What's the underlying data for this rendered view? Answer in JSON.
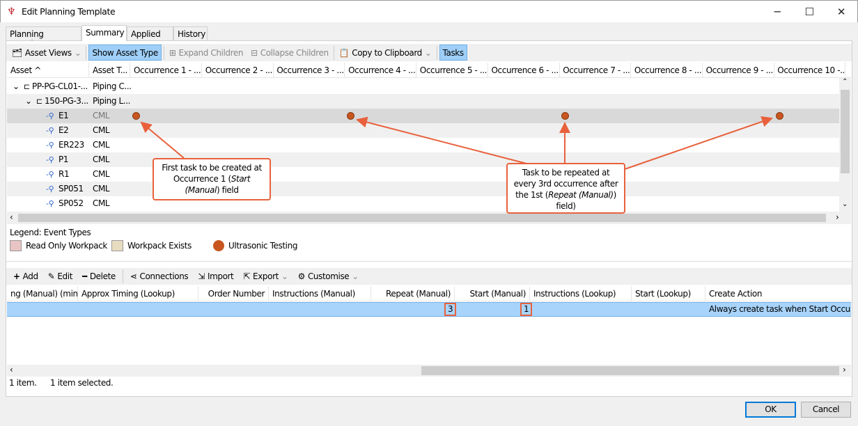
{
  "window": {
    "title": "Edit Planning Template",
    "minimize": "─",
    "maximize": "☐",
    "close": "✕"
  },
  "tabs": [
    {
      "label": "Planning Template"
    },
    {
      "label": "Summary"
    },
    {
      "label": "Applied To"
    },
    {
      "label": "History"
    }
  ],
  "toolbar": {
    "asset_views": "Asset Views",
    "show_asset_type": "Show Asset Type",
    "expand_children": "Expand Children",
    "collapse_children": "Collapse Children",
    "copy_to_clipboard": "Copy to Clipboard",
    "tasks": "Tasks"
  },
  "grid": {
    "headers": [
      "Asset ^",
      "Asset T...",
      "Occurrence 1 - ...",
      "Occurrence 2 - ...",
      "Occurrence 3 - ...",
      "Occurrence 4 - ...",
      "Occurrence 5 - ...",
      "Occurrence 6 - ...",
      "Occurrence 7 - ...",
      "Occurrence 8 - ...",
      "Occurrence 9 - ...",
      "Occurrence 10 -..."
    ],
    "rows": [
      {
        "asset": "PP-PG-CL01-...",
        "type": "Piping C...",
        "level": 0,
        "icon": "pipe-icon",
        "expanded": true
      },
      {
        "asset": "150-PG-3...",
        "type": "Piping L...",
        "level": 1,
        "icon": "pipe-icon",
        "expanded": true
      },
      {
        "asset": "E1",
        "type": "CML",
        "level": 2,
        "icon": "cml-icon",
        "selected": true,
        "events": [
          1,
          4,
          7,
          10
        ]
      },
      {
        "asset": "E2",
        "type": "CML",
        "level": 2,
        "icon": "cml-icon"
      },
      {
        "asset": "ER223",
        "type": "CML",
        "level": 2,
        "icon": "cml-icon"
      },
      {
        "asset": "P1",
        "type": "CML",
        "level": 2,
        "icon": "cml-icon"
      },
      {
        "asset": "R1",
        "type": "CML",
        "level": 2,
        "icon": "cml-icon"
      },
      {
        "asset": "SP051",
        "type": "CML",
        "level": 2,
        "icon": "cml-icon"
      },
      {
        "asset": "SP052",
        "type": "CML",
        "level": 2,
        "icon": "cml-icon"
      }
    ]
  },
  "callouts": {
    "first": {
      "line1": "First task to be created at",
      "line2": "Occurrence 1 (",
      "em": "Start",
      "line3a": "(Manual",
      ") field": ") field"
    },
    "repeat": {
      "line1": "Task to be repeated at",
      "line2": "every 3rd occurrence after",
      "line3": "the 1st (",
      "em": "Repeat (Manual)",
      "line3b": ")",
      "line4": "field)"
    }
  },
  "legend": {
    "title": "Legend: Event Types",
    "items": [
      {
        "label": "Read Only Workpack",
        "color": "#e8c4c4"
      },
      {
        "label": "Workpack Exists",
        "color": "#e8dcc0"
      },
      {
        "label": "Ultrasonic Testing",
        "color": "#c8561f"
      }
    ]
  },
  "tasks_toolbar": {
    "add": "Add",
    "edit": "Edit",
    "delete": "Delete",
    "connections": "Connections",
    "import": "Import",
    "export": "Export",
    "customise": "Customise"
  },
  "tasks_grid": {
    "headers": [
      "ng (Manual) (min)",
      "Approx Timing (Lookup)",
      "Order Number",
      "Instructions (Manual)",
      "Repeat (Manual)",
      "Start (Manual)",
      "Instructions (Lookup)",
      "Start (Lookup)",
      "Create Action"
    ],
    "row": {
      "repeat": "3",
      "start": "1",
      "create_action": "Always create task when Start Occurren"
    }
  },
  "status": {
    "count": "1 item.",
    "selected": "1 item selected."
  },
  "footer": {
    "ok": "OK",
    "cancel": "Cancel"
  },
  "colors": {
    "accent": "#e8613c",
    "selection": "#a8d4fb",
    "event": "#c8561f"
  }
}
